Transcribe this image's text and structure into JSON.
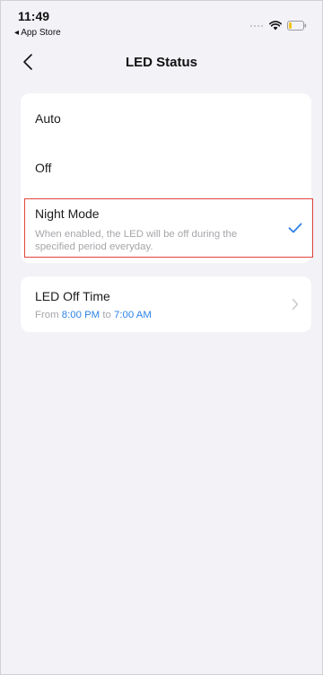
{
  "status_bar": {
    "time": "11:49",
    "back_label": "◂ App Store",
    "signal_icon": "signal-dots-icon",
    "wifi_icon": "wifi-icon",
    "battery_icon": "battery-icon"
  },
  "nav": {
    "back_icon": "chevron-left-icon",
    "title": "LED Status"
  },
  "led_options": [
    {
      "label": "Auto"
    },
    {
      "label": "Off"
    }
  ],
  "night_mode": {
    "title": "Night Mode",
    "description": "When enabled, the LED will be off during the specified period everyday.",
    "selected": true,
    "check_icon": "checkmark-icon"
  },
  "off_time": {
    "title": "LED Off Time",
    "prefix": "From",
    "start": "8:00 PM",
    "connector": "to",
    "end": "7:00 AM",
    "chevron_icon": "chevron-right-icon"
  },
  "colors": {
    "accent": "#2f83e6",
    "highlight_border": "#e3433b",
    "background": "#f2f2f7",
    "card": "#ffffff",
    "muted_text": "#a6a6ab"
  }
}
